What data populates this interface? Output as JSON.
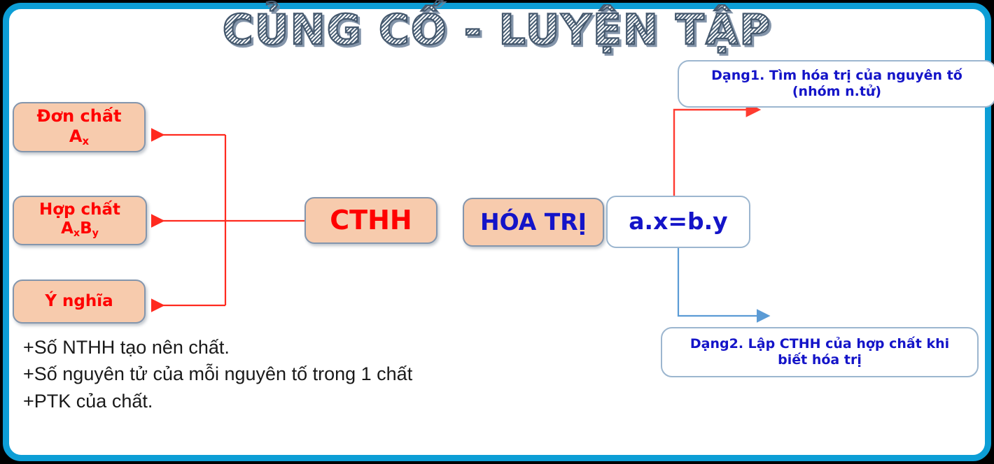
{
  "slide": {
    "title": "CỦNG CỐ - LUYỆN TẬP",
    "frame_color": "#0c9ed6",
    "background": "#ffffff"
  },
  "nodes": {
    "don_chat": {
      "line1": "Đơn chất",
      "line2_base": "A",
      "line2_sub": "x",
      "fill": "#f7cbad",
      "text_color": "#ff0000"
    },
    "hop_chat": {
      "line1": "Hợp chất",
      "line2_a": "A",
      "line2_a_sub": "x",
      "line2_b": "B",
      "line2_b_sub": "y",
      "fill": "#f7cbad",
      "text_color": "#ff0000"
    },
    "y_nghia": {
      "label": "Ý nghĩa",
      "fill": "#f7cbad",
      "text_color": "#ff0000"
    },
    "cthh": {
      "label": "CTHH",
      "fill": "#f7cbad",
      "text_color": "#ff0000"
    },
    "hoa_tri": {
      "label": "HÓA TRỊ",
      "fill": "#f7cbad",
      "text_color": "#1414c8"
    },
    "axby": {
      "label": "a.x=b.y",
      "fill": "#ffffff",
      "text_color": "#1414c8"
    },
    "dang1": {
      "line1": "Dạng1. Tìm hóa trị của nguyên tố",
      "line2": "(nhóm n.tử)",
      "fill": "#ffffff",
      "text_color": "#1414c8"
    },
    "dang2": {
      "line1": "Dạng2. Lập CTHH của hợp chất khi",
      "line2": "biết hóa trị",
      "fill": "#ffffff",
      "text_color": "#1414c8"
    }
  },
  "bullets": {
    "line1": "+Số NTHH tạo nên chất.",
    "line2": "+Số nguyên tử của mỗi nguyên tố trong 1 chất",
    "line3": "+PTK của chất."
  },
  "connectors": {
    "left_branch_color": "#ff2a1f",
    "up_branch_color": "#ff3b30",
    "down_branch_color": "#5b9bd5"
  }
}
